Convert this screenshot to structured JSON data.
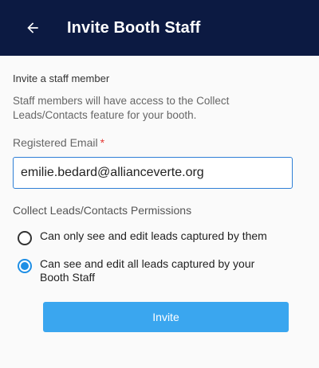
{
  "header": {
    "back_icon": "arrow-left-icon",
    "title": "Invite Booth Staff"
  },
  "form": {
    "section_title": "Invite a staff member",
    "description": "Staff members will have access to the Collect Leads/Contacts feature for your booth.",
    "email_label": "Registered Email",
    "required_mark": "*",
    "email_value": "emilie.bedard@allianceverte.org",
    "permissions_title": "Collect Leads/Contacts Permissions",
    "options": [
      {
        "label": "Can only see and edit leads captured by them",
        "selected": false
      },
      {
        "label": "Can see and edit all leads captured by your Booth Staff",
        "selected": true
      }
    ],
    "invite_label": "Invite"
  },
  "colors": {
    "header_bg": "#0c1a42",
    "accent": "#1f8fe5",
    "button_bg": "#3aa6ef",
    "required": "#e53935"
  }
}
